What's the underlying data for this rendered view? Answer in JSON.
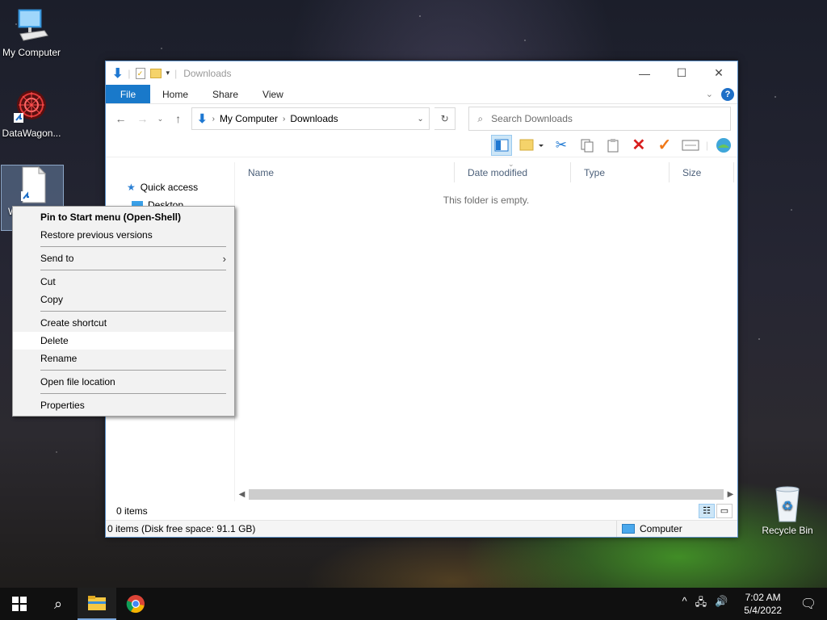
{
  "desktop": {
    "icons": [
      {
        "label": "My Computer"
      },
      {
        "label": "DataWagon..."
      },
      {
        "label": "W"
      },
      {
        "label": "Recycle Bin"
      }
    ]
  },
  "explorer": {
    "title": "Downloads",
    "ribbon_tabs": [
      "File",
      "Home",
      "Share",
      "View"
    ],
    "address": {
      "segments": [
        "My Computer",
        "Downloads"
      ]
    },
    "search_placeholder": "Search Downloads",
    "nav_pane": {
      "items": [
        "Quick access",
        "Desktop"
      ]
    },
    "columns": [
      "Name",
      "Date modified",
      "Type",
      "Size"
    ],
    "empty_message": "This folder is empty.",
    "item_count": "0 items",
    "status_left": "0 items (Disk free space: 91.1 GB)",
    "status_right": "Computer"
  },
  "context_menu": {
    "items": [
      {
        "label": "Pin to Start menu (Open-Shell)",
        "bold": true
      },
      {
        "label": "Restore previous versions"
      },
      {
        "label": "Send to",
        "submenu": true
      },
      {
        "label": "Cut"
      },
      {
        "label": "Copy"
      },
      {
        "label": "Create shortcut"
      },
      {
        "label": "Delete",
        "highlighted": true
      },
      {
        "label": "Rename"
      },
      {
        "label": "Open file location"
      },
      {
        "label": "Properties"
      }
    ]
  },
  "taskbar": {
    "clock_time": "7:02 AM",
    "clock_date": "5/4/2022"
  },
  "colors": {
    "accent": "#1979ca",
    "delete_red": "#d81e1e",
    "check_orange": "#f07818"
  }
}
